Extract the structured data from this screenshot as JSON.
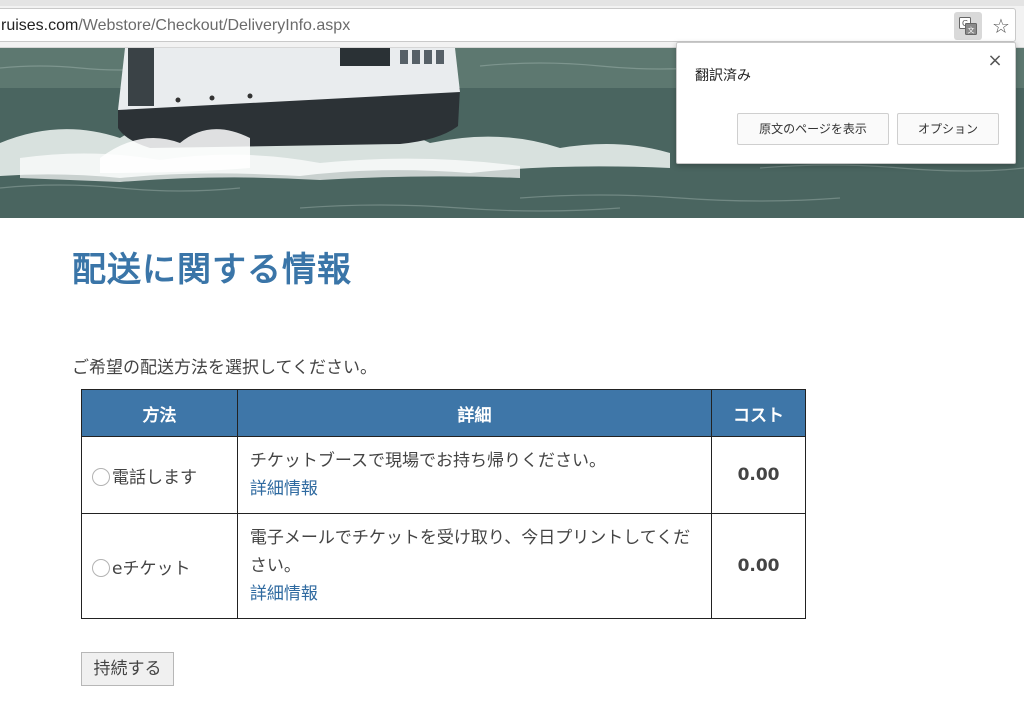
{
  "browser": {
    "url_host": "ruises.com",
    "url_path": "/Webstore/Checkout/DeliveryInfo.aspx"
  },
  "translate_popup": {
    "title": "翻訳済み",
    "close": "×",
    "show_original": "原文のページを表示",
    "options": "オプション"
  },
  "page": {
    "title": "配送に関する情報",
    "instruction": "ご希望の配送方法を選択してください。"
  },
  "table": {
    "headers": {
      "method": "方法",
      "detail": "詳細",
      "cost": "コスト"
    },
    "rows": [
      {
        "method": "電話します",
        "detail": "チケットブースで現場でお持ち帰りください。",
        "link": "詳細情報",
        "cost": "0.00"
      },
      {
        "method": "eチケット",
        "detail": "電子メールでチケットを受け取り、今日プリントしてください。",
        "link": "詳細情報",
        "cost": "0.00"
      }
    ]
  },
  "continue_button": "持続する",
  "icons": {
    "translate": "translate-icon",
    "star": "bookmark-star-icon",
    "close": "close-icon"
  },
  "colors": {
    "accent": "#3a75a8",
    "header_bg": "#3e76a8",
    "link": "#2f6aa0"
  }
}
